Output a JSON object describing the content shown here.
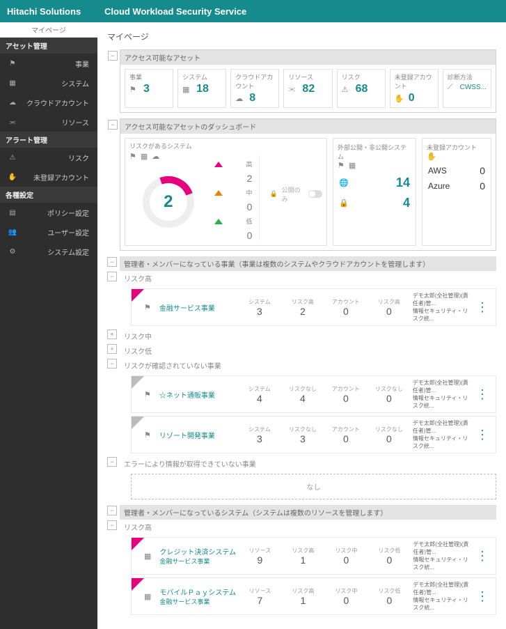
{
  "header": {
    "brand": "Hitachi Solutions",
    "app": "Cloud Workload Security Service"
  },
  "sidebar": {
    "mypage": "マイページ",
    "groups": [
      {
        "title": "アセット管理",
        "items": [
          {
            "icon": "flag",
            "label": "事業"
          },
          {
            "icon": "grid",
            "label": "システム"
          },
          {
            "icon": "cloud",
            "label": "クラウドアカウント"
          },
          {
            "icon": "nodes",
            "label": "リソース"
          }
        ]
      },
      {
        "title": "アラート管理",
        "items": [
          {
            "icon": "warn",
            "label": "リスク"
          },
          {
            "icon": "hand",
            "label": "未登録アカウント"
          }
        ]
      },
      {
        "title": "各種設定",
        "items": [
          {
            "icon": "doc",
            "label": "ポリシー設定"
          },
          {
            "icon": "users",
            "label": "ユーザー設定"
          },
          {
            "icon": "gear",
            "label": "システム設定"
          }
        ]
      }
    ]
  },
  "page": {
    "title": "マイページ"
  },
  "assets_panel": {
    "title": "アクセス可能なアセット",
    "stats": [
      {
        "icon": "flag",
        "label": "事業",
        "value": "3"
      },
      {
        "icon": "grid",
        "label": "システム",
        "value": "18"
      },
      {
        "icon": "cloud",
        "label": "クラウドアカウント",
        "value": "8"
      },
      {
        "icon": "nodes",
        "label": "リソース",
        "value": "82"
      },
      {
        "icon": "warn",
        "label": "リスク",
        "value": "68"
      },
      {
        "icon": "hand",
        "label": "未登録アカウント",
        "value": "0"
      },
      {
        "icon": "wand",
        "label": "診断方法",
        "text": "CWSS..."
      }
    ]
  },
  "dashboard_panel": {
    "title": "アクセス可能なアセットのダッシュボード",
    "risky_systems": {
      "title": "リスクがあるシステム",
      "center": "2",
      "public_only": "公開のみ",
      "legend": [
        {
          "color": "#e6007e",
          "label": "高",
          "value": "2"
        },
        {
          "color": "#f08000",
          "label": "中",
          "value": "0"
        },
        {
          "color": "#2bb04a",
          "label": "低",
          "value": "0"
        }
      ]
    },
    "public_systems": {
      "title": "外部公開・非公開システム",
      "rows": [
        {
          "icon": "globe",
          "value": "14"
        },
        {
          "icon": "lock",
          "value": "4"
        }
      ]
    },
    "unreg_accounts": {
      "title": "未登録アカウント",
      "rows": [
        {
          "label": "AWS",
          "value": "0"
        },
        {
          "label": "Azure",
          "value": "0"
        }
      ]
    }
  },
  "biz_section": {
    "title": "管理者・メンバーになっている事業（事業は複数のシステムやクラウドアカウントを管理します）",
    "groups": {
      "high": {
        "label": "リスク高",
        "rows": [
          {
            "name": "金融サービス事業",
            "metrics": [
              {
                "l": "システム",
                "v": "3"
              },
              {
                "l": "リスク高",
                "v": "2"
              },
              {
                "l": "アカウント",
                "v": "0"
              },
              {
                "l": "リスク高",
                "v": "0"
              }
            ],
            "owner1": "デモ太郎(全社管理)(責任者)管...",
            "owner2": "情報セキュリティ・リスク統..."
          }
        ]
      },
      "mid": {
        "label": "リスク中"
      },
      "low": {
        "label": "リスク低"
      },
      "none": {
        "label": "リスクが確認されていない事業",
        "rows": [
          {
            "name": "☆ネット通販事業",
            "metrics": [
              {
                "l": "システム",
                "v": "4"
              },
              {
                "l": "リスクなし",
                "v": "4"
              },
              {
                "l": "アカウント",
                "v": "0"
              },
              {
                "l": "リスクなし",
                "v": "0"
              }
            ],
            "owner1": "デモ太郎(全社管理)(責任者)管...",
            "owner2": "情報セキュリティ・リスク統..."
          },
          {
            "name": "リゾート開発事業",
            "metrics": [
              {
                "l": "システム",
                "v": "3"
              },
              {
                "l": "リスクなし",
                "v": "3"
              },
              {
                "l": "アカウント",
                "v": "0"
              },
              {
                "l": "リスクなし",
                "v": "0"
              }
            ],
            "owner1": "デモ太郎(全社管理)(責任者)管...",
            "owner2": "情報セキュリティ・リスク統..."
          }
        ]
      },
      "error": {
        "label": "エラーにより情報が取得できていない事業",
        "empty": "なし"
      }
    }
  },
  "sys_section": {
    "title": "管理者・メンバーになっているシステム（システムは複数のリソースを管理します）",
    "high": {
      "label": "リスク高",
      "rows": [
        {
          "name": "クレジット決済システム",
          "sub": "金融サービス事業",
          "metrics": [
            {
              "l": "リソース",
              "v": "9"
            },
            {
              "l": "リスク高",
              "v": "1"
            },
            {
              "l": "リスク中",
              "v": "0"
            },
            {
              "l": "リスク低",
              "v": "0"
            }
          ],
          "owner1": "デモ太郎(全社管理)(責任者)管...",
          "owner2": "情報セキュリティ・リスク統..."
        },
        {
          "name": "モバイルＰａｙシステム",
          "sub": "金融サービス事業",
          "metrics": [
            {
              "l": "リソース",
              "v": "7"
            },
            {
              "l": "リスク高",
              "v": "1"
            },
            {
              "l": "リスク中",
              "v": "0"
            },
            {
              "l": "リスク低",
              "v": "0"
            }
          ],
          "owner1": "デモ太郎(全社管理)(責任者)管...",
          "owner2": "情報セキュリティ・リスク統..."
        }
      ]
    }
  }
}
